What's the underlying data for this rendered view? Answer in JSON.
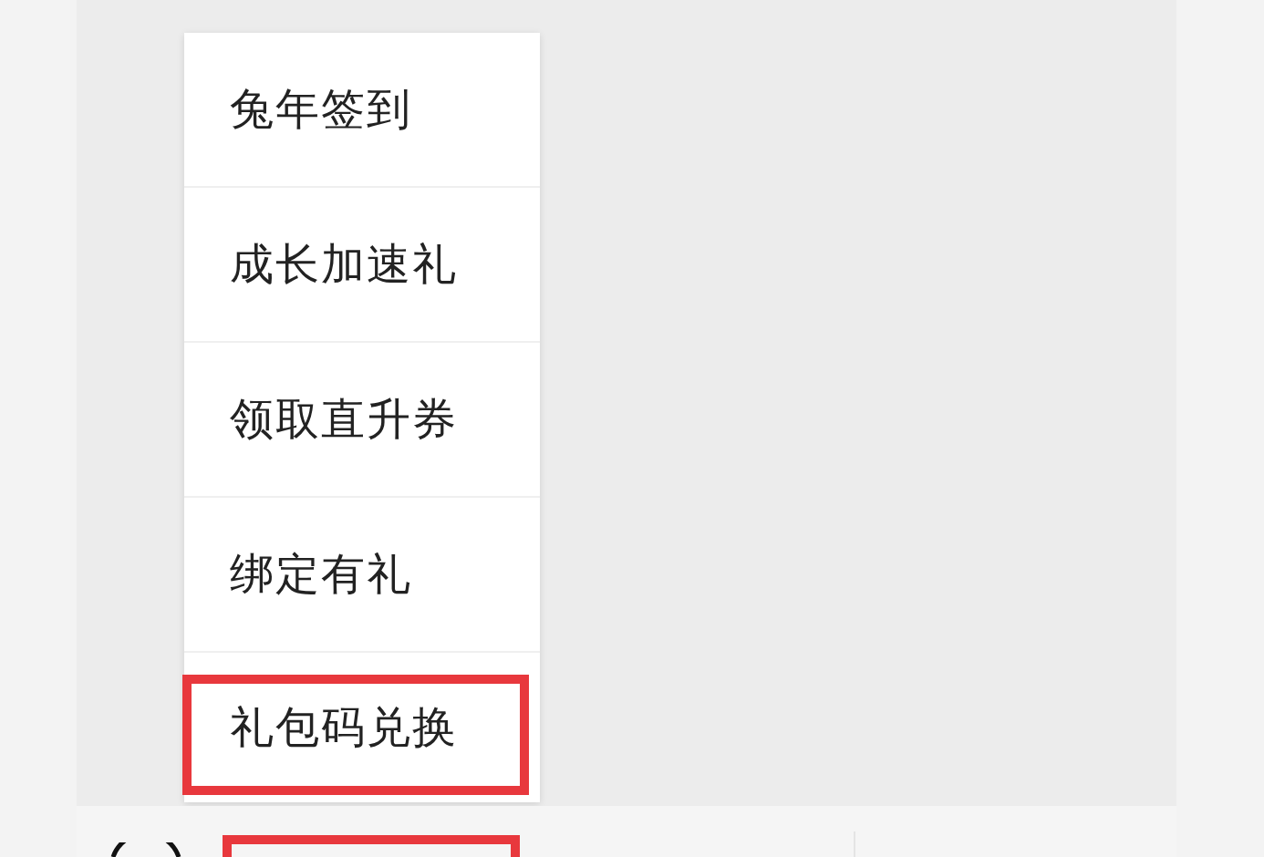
{
  "menu": {
    "items": [
      {
        "label": "兔年签到",
        "highlighted": false
      },
      {
        "label": "成长加速礼",
        "highlighted": false
      },
      {
        "label": "领取直升券",
        "highlighted": false
      },
      {
        "label": "绑定有礼",
        "highlighted": false
      },
      {
        "label": "礼包码兑换",
        "highlighted": true
      }
    ]
  },
  "bottom_bar": {
    "highlighted": true
  }
}
